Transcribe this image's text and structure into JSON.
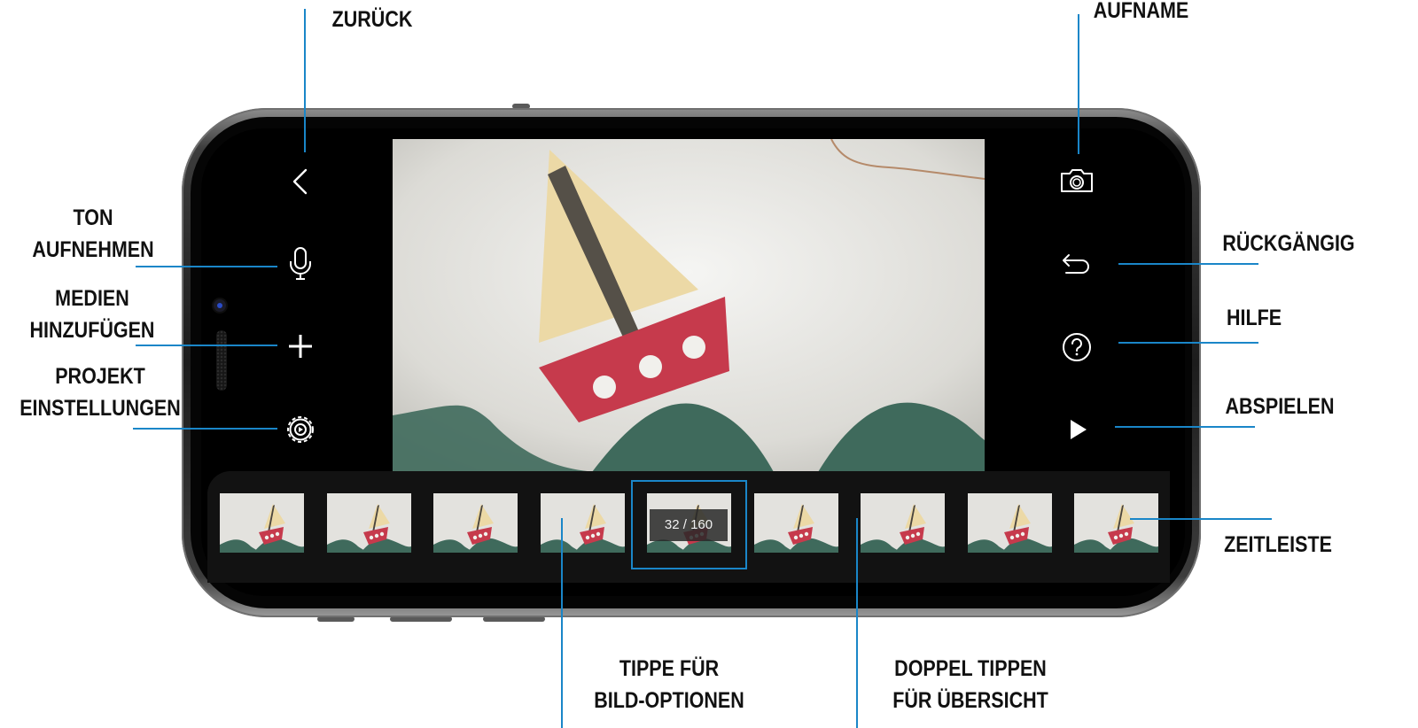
{
  "annotations": {
    "back": [
      "ZURÜCK"
    ],
    "capture": [
      "AUFNAME"
    ],
    "record_sound": [
      "TON",
      "AUFNEHMEN"
    ],
    "add_media": [
      "MEDIEN",
      "HINZUFÜGEN"
    ],
    "project_settings": [
      "PROJEKT",
      "EINSTELLUNGEN"
    ],
    "undo": [
      "RÜCKGÄNGIG"
    ],
    "help": [
      "HILFE"
    ],
    "play": [
      "ABSPIELEN"
    ],
    "timeline": [
      "ZEITLEISTE"
    ],
    "tap_options": [
      "TIPPE FÜR",
      "BILD-OPTIONEN"
    ],
    "double_tap": [
      "DOPPEL TIPPEN",
      "FÜR ÜBERSICHT"
    ]
  },
  "toolbar_left": [
    "back-icon",
    "microphone-icon",
    "plus-icon",
    "settings-gear-icon"
  ],
  "toolbar_right": [
    "camera-icon",
    "undo-icon",
    "help-icon",
    "play-icon"
  ],
  "timeline": {
    "frame_counter": "32 / 160",
    "thumbnail_count": 9,
    "selected_index": 4
  },
  "colors": {
    "callout_line": "#1a86c8",
    "selection": "#1a86c8",
    "boat_hull": "#c63a4c",
    "sail": "#ecd9a6",
    "waves": "#3f6a5c"
  }
}
